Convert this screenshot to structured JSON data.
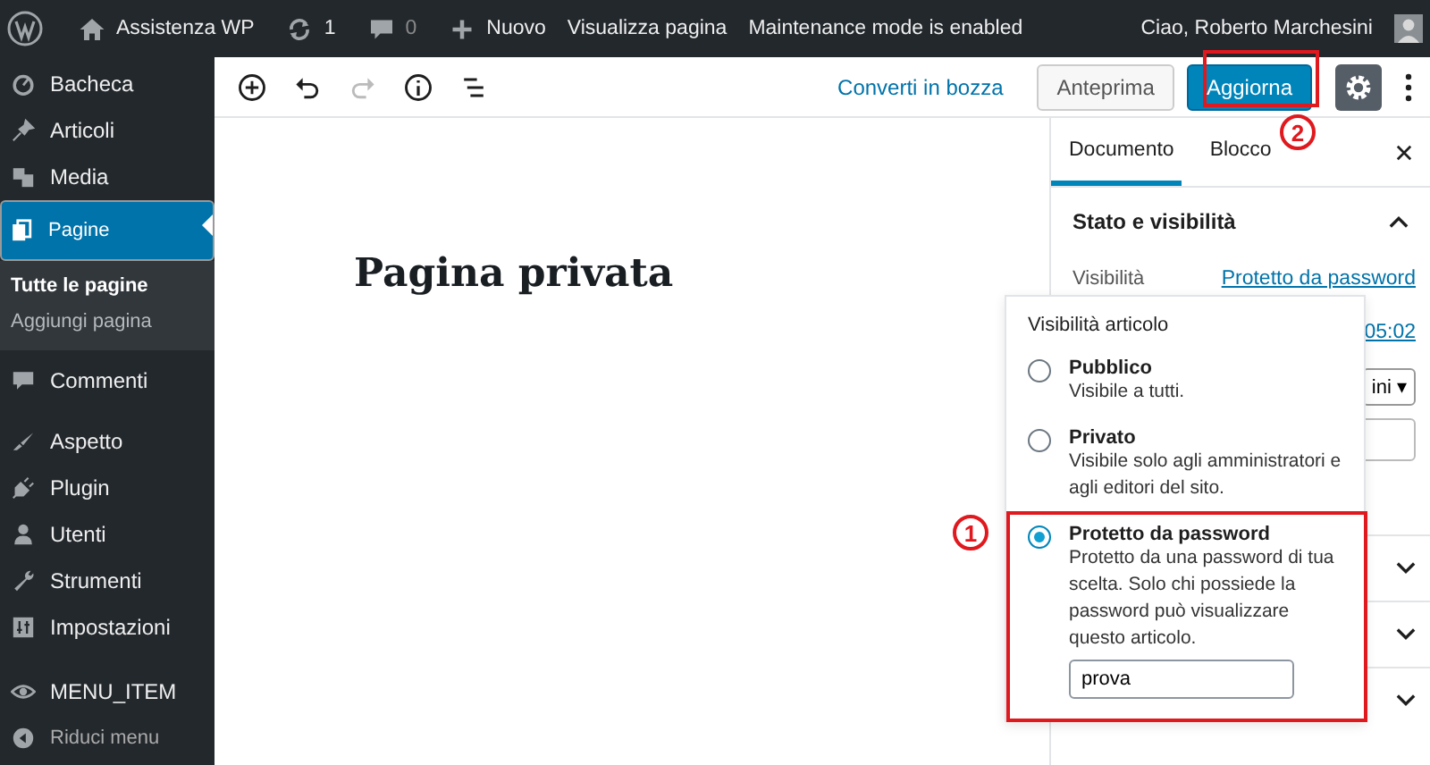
{
  "admin_bar": {
    "site": "Assistenza WP",
    "updates": "1",
    "comments": "0",
    "new": "Nuovo",
    "view": "Visualizza pagina",
    "maintenance": "Maintenance mode is enabled",
    "greeting": "Ciao, Roberto Marchesini"
  },
  "menu": [
    {
      "label": "Bacheca",
      "kind": "dashboard",
      "selected": false
    },
    {
      "label": "Articoli",
      "kind": "pin",
      "selected": false
    },
    {
      "label": "Media",
      "kind": "media",
      "selected": false
    },
    {
      "label": "Pagine",
      "kind": "pages",
      "selected": true,
      "children": [
        {
          "label": "Tutte le pagine",
          "selected": true
        },
        {
          "label": "Aggiungi pagina",
          "selected": false
        }
      ]
    },
    {
      "label": "Commenti",
      "kind": "comment",
      "selected": false
    },
    {
      "label": "Aspetto",
      "kind": "brush",
      "selected": false
    },
    {
      "label": "Plugin",
      "kind": "plug",
      "selected": false
    },
    {
      "label": "Utenti",
      "kind": "user",
      "selected": false
    },
    {
      "label": "Strumenti",
      "kind": "wrench",
      "selected": false
    },
    {
      "label": "Impostazioni",
      "kind": "settings",
      "selected": false
    },
    {
      "label": "MENU_ITEM",
      "kind": "eye",
      "selected": false
    },
    {
      "label": "Riduci menu",
      "kind": "collapse",
      "selected": false
    }
  ],
  "toolbar": {
    "convert": "Converti in bozza",
    "preview": "Anteprima",
    "update": "Aggiorna"
  },
  "page_title": "Pagina privata",
  "settings": {
    "tabs": [
      {
        "label": "Documento",
        "selected": true
      },
      {
        "label": "Blocco",
        "selected": false
      }
    ],
    "panel_title": "Stato e visibilità",
    "expanded": true,
    "visibility_label": "Visibilità",
    "visibility_value": "Protetto da password",
    "publish_time": "05:02",
    "template": "ini",
    "template_caret": "▾",
    "panels": [
      {
        "expanded": false
      },
      {
        "expanded": false
      },
      {
        "expanded": false
      }
    ]
  },
  "popover": {
    "title": "Visibilità articolo",
    "options": [
      {
        "label": "Pubblico",
        "description": "Visibile a tutti.",
        "selected": false
      },
      {
        "label": "Privato",
        "description": "Visibile solo agli amministratori e agli editori del sito.",
        "selected": false
      },
      {
        "label": "Protetto da password",
        "description": "Protetto da una password di tua scelta. Solo chi possiede la password può visualizzare questo articolo.",
        "selected": true
      }
    ],
    "password": "prova"
  },
  "annotations": [
    {
      "number": "1"
    },
    {
      "number": "2"
    }
  ]
}
